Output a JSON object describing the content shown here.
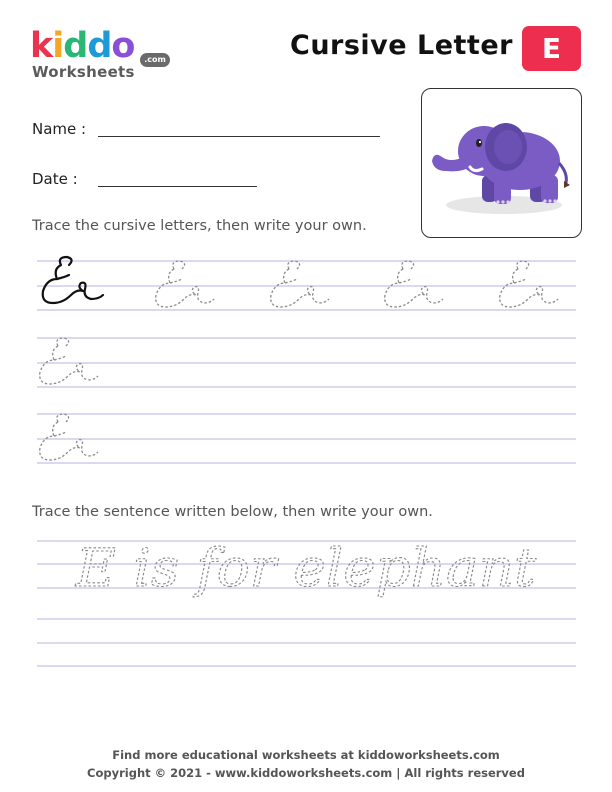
{
  "brand": {
    "logo_letters": [
      "k",
      "i",
      "d",
      "d",
      "o"
    ],
    "logo_colors": [
      "#e8344e",
      "#f5a623",
      "#2ab673",
      "#1e9bd7",
      "#8a4fd6"
    ],
    "logo_sub": "Worksheets",
    "logo_com": ".com"
  },
  "header": {
    "title": "Cursive Letter",
    "letter": "E",
    "badge_color": "#ee2e4e"
  },
  "form": {
    "name_label": "Name :",
    "date_label": "Date :"
  },
  "illustration": {
    "icon": "elephant-icon",
    "body_color": "#7b5bc4"
  },
  "section1": {
    "instruction": "Trace the cursive letters, then write your own.",
    "letter_pair": "Ee"
  },
  "section2": {
    "instruction": "Trace the sentence written below, then write your own.",
    "sentence": "E is for elephant"
  },
  "footer": {
    "line1": "Find more educational worksheets at kiddoworksheets.com",
    "line2": "Copyright © 2021 - www.kiddoworksheets.com  |  All rights reserved"
  },
  "colors": {
    "guide_line": "#c5c2e6",
    "dotted_trace": "#8a8a8a"
  }
}
